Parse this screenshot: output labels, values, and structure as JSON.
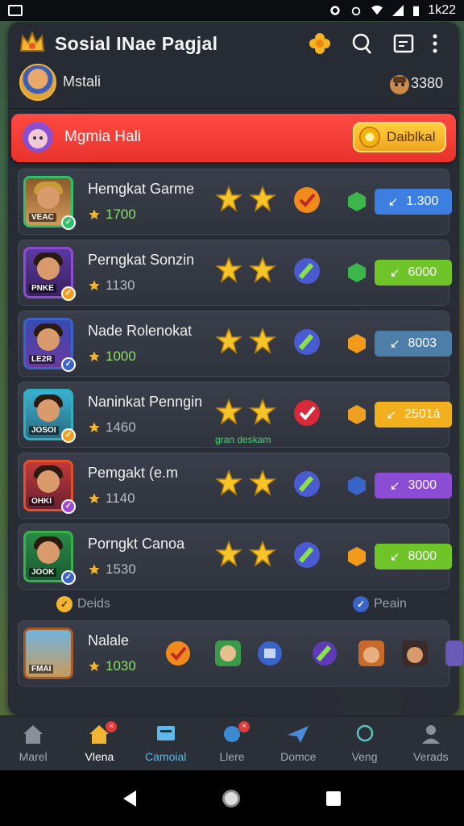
{
  "status_bar": {
    "time": "1k22"
  },
  "header": {
    "title": "Sosial INae Pagjal",
    "profile_name": "Mstali",
    "coins": "3380"
  },
  "banner": {
    "title": "Mgmia Hali",
    "button_label": "Daiblkal"
  },
  "rows": [
    {
      "name": "Hemgkat Garme",
      "score": "1700",
      "tag": "VEAC",
      "value": "1.300",
      "btn_color": "#3d7fe0",
      "gem_color": "#3cb64a",
      "action": "check",
      "score_style": "green"
    },
    {
      "name": "Perngkat Sonzin",
      "score": "1130",
      "tag": "PNKE",
      "value": "6000",
      "btn_color": "#6fc42a",
      "gem_color": "#3cb64a",
      "action": "pen",
      "score_style": "gray"
    },
    {
      "name": "Nade Rolenokat",
      "score": "1000",
      "tag": "LE2R",
      "value": "8003",
      "btn_color": "#4c7ea8",
      "gem_color": "#f29a1a",
      "action": "pen",
      "score_style": "green"
    },
    {
      "name": "Naninkat Penngin",
      "score": "1460",
      "tag": "JOSOI",
      "value": "2501á",
      "btn_color": "#f2b01e",
      "gem_color": "#f0a020",
      "action": "check-red",
      "score_style": "gray",
      "subtext": "gran deskam"
    },
    {
      "name": "Pemgakt (e.m",
      "score": "1140",
      "tag": "OHKI",
      "value": "3000",
      "btn_color": "#8c4cd4",
      "gem_color": "#3a64c8",
      "action": "pen",
      "score_style": "gray"
    },
    {
      "name": "Porngkt Canoa",
      "score": "1530",
      "tag": "JOOK",
      "value": "8000",
      "btn_color": "#6fc42a",
      "gem_color": "#f29a1a",
      "action": "pen",
      "score_style": "gray"
    }
  ],
  "sections": {
    "left": "Deids",
    "right": "Peain"
  },
  "bottom_row": {
    "name": "Nalale",
    "score": "1030",
    "tag": "FMAI"
  },
  "nav": [
    {
      "label": "Marel",
      "icon": "house-icon"
    },
    {
      "label": "Vlena",
      "icon": "house-badge-icon"
    },
    {
      "label": "Camoial",
      "icon": "chat-icon"
    },
    {
      "label": "Llere",
      "icon": "rocket-icon"
    },
    {
      "label": "Domce",
      "icon": "plane-icon"
    },
    {
      "label": "Veng",
      "icon": "search-icon"
    },
    {
      "label": "Verads",
      "icon": "person-icon"
    }
  ]
}
